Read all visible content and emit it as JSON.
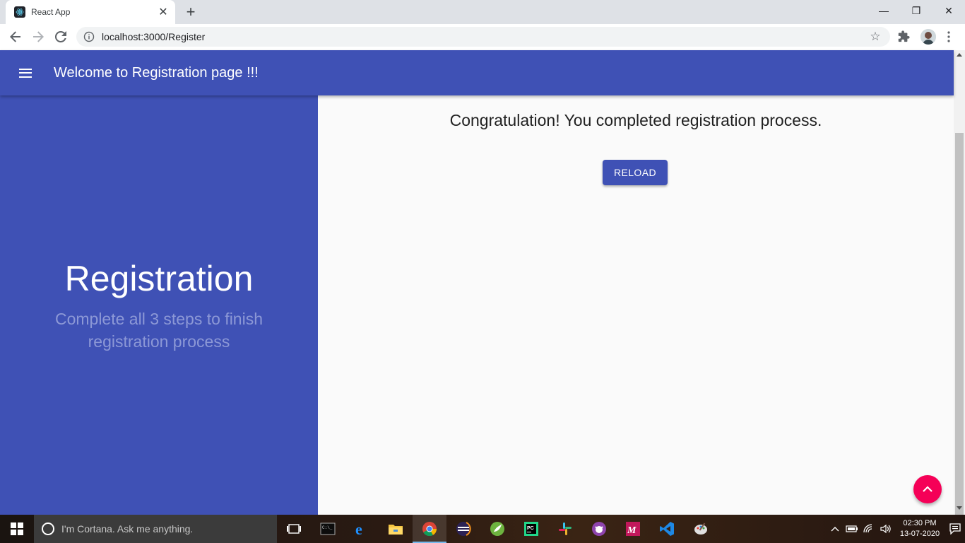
{
  "browser": {
    "tab_title": "React App",
    "tab_close": "✕",
    "new_tab": "+",
    "url": "localhost:3000/Register",
    "window_controls": {
      "minimize": "—",
      "restore": "❐",
      "close": "✕"
    }
  },
  "appbar": {
    "title": "Welcome to Registration page !!!",
    "color": "#3f51b5"
  },
  "sidebar": {
    "title": "Registration",
    "subtitle": "Complete all 3 steps to finish registration process"
  },
  "main": {
    "message": "Congratulation! You completed registration process.",
    "reload_label": "RELOAD"
  },
  "fab": {
    "icon": "chevron-up-icon",
    "color": "#f50057"
  },
  "taskbar": {
    "cortana_placeholder": "I'm Cortana. Ask me anything.",
    "apps": [
      "task-view-icon",
      "terminal-icon",
      "edge-icon",
      "file-explorer-icon",
      "chrome-icon",
      "eclipse-icon",
      "spring-icon",
      "pycharm-icon",
      "slack-icon",
      "github-desktop-icon",
      "postman-icon",
      "vscode-icon",
      "paint-icon"
    ],
    "active_app": "chrome-icon",
    "time": "02:30 PM",
    "date": "13-07-2020"
  }
}
